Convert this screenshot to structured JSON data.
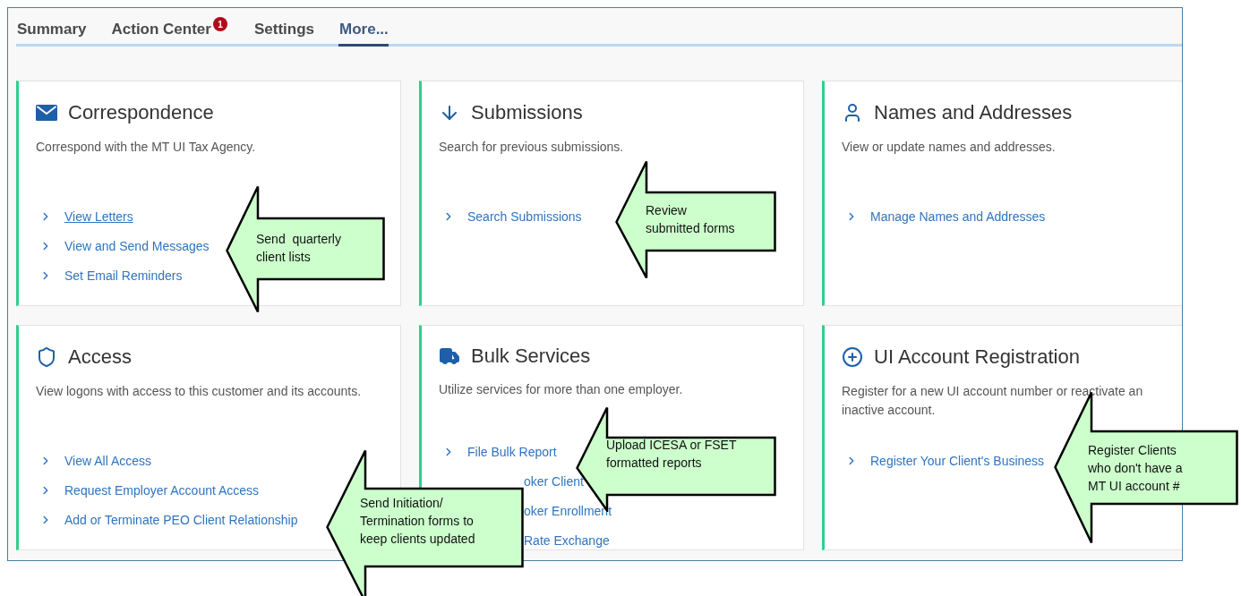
{
  "tabs": [
    {
      "label": "Summary",
      "selected": false
    },
    {
      "label": "Action Center",
      "selected": false,
      "badge": "1"
    },
    {
      "label": "Settings",
      "selected": false
    },
    {
      "label": "More...",
      "selected": true
    }
  ],
  "cards": [
    {
      "title": "Correspondence",
      "description": "Correspond with the MT UI Tax Agency.",
      "links": [
        {
          "label": "View Letters",
          "kind": "full",
          "hovered": true
        },
        {
          "label": "View and Send Messages",
          "kind": "full",
          "hovered": false
        },
        {
          "label": "Set Email Reminders",
          "kind": "full",
          "hovered": false
        }
      ]
    },
    {
      "title": "Submissions",
      "description": "Search for previous submissions.",
      "links": [
        {
          "label": "Search Submissions",
          "kind": "full",
          "hovered": false
        }
      ]
    },
    {
      "title": "Names and Addresses",
      "description": "View or update names and addresses.",
      "links": [
        {
          "label": "Manage Names and Addresses",
          "kind": "full",
          "hovered": false
        }
      ]
    },
    {
      "title": "Access",
      "description": "View logons with access to this customer and its accounts.",
      "links": [
        {
          "label": "View All Access",
          "kind": "full",
          "hovered": false
        },
        {
          "label": "Request Employer Account Access",
          "kind": "full",
          "hovered": false
        },
        {
          "label": "Add or Terminate PEO Client Relationship",
          "kind": "full",
          "hovered": false
        }
      ]
    },
    {
      "title": "Bulk Services",
      "description": "Utilize services for more than one employer.",
      "links": [
        {
          "label": "File Bulk Report",
          "kind": "full",
          "hovered": false
        },
        {
          "label": "oker Client",
          "kind": "covered",
          "hovered": false
        },
        {
          "label": "oker Enrollment",
          "kind": "covered",
          "hovered": false
        },
        {
          "label": "Rate Exchange",
          "kind": "covered",
          "hovered": false
        }
      ]
    },
    {
      "title": "UI Account Registration",
      "description": "Register for a new UI account number or reactivate an inactive account.",
      "links": [
        {
          "label": "Register Your Client's Business",
          "kind": "full",
          "hovered": false
        }
      ]
    }
  ],
  "callouts": [
    {
      "lines": [
        "Send  quarterly",
        "client lists"
      ]
    },
    {
      "lines": [
        "Review",
        "submitted forms"
      ]
    },
    {
      "lines": [
        "Upload ICESA or FSET",
        "formatted reports"
      ]
    },
    {
      "lines": [
        "Send Initiation/",
        "Termination forms to",
        "keep clients updated"
      ]
    },
    {
      "lines": [
        "Register Clients",
        "who don't have a",
        "MT UI account #"
      ]
    }
  ]
}
